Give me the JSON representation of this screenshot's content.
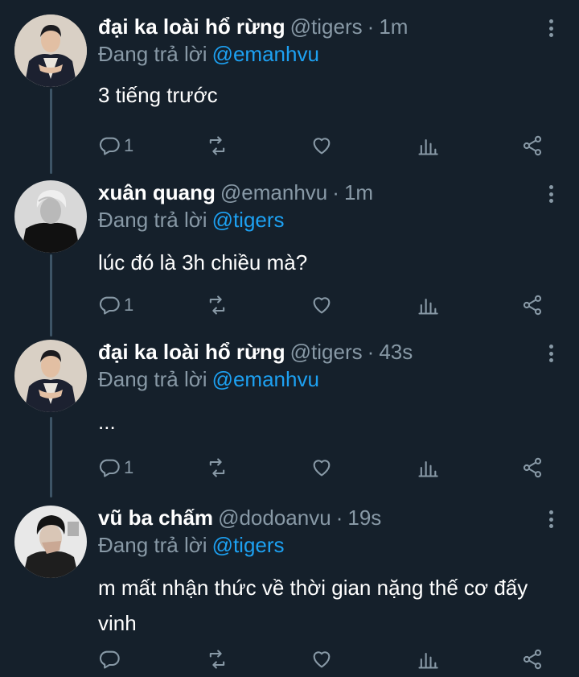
{
  "reply_prefix": "Đang trả lời",
  "colors": {
    "background": "#15202b",
    "secondary_text": "#8899a6",
    "mention": "#1da1f2",
    "thread_line": "#3d5466"
  },
  "tweets": [
    {
      "name": "đại ka loài hổ rừng",
      "handle": "@tigers",
      "time": "1m",
      "reply_to": "@emanhvu",
      "text": "3 tiếng trước",
      "reply_count": "1",
      "avatar": "tigers-avatar"
    },
    {
      "name": "xuân quang",
      "handle": "@emanhvu",
      "time": "1m",
      "reply_to": "@tigers",
      "text": "lúc đó là 3h chiều mà?",
      "reply_count": "1",
      "avatar": "emanhvu-avatar"
    },
    {
      "name": "đại ka loài hổ rừng",
      "handle": "@tigers",
      "time": "43s",
      "reply_to": "@emanhvu",
      "text": "...",
      "reply_count": "1",
      "avatar": "tigers-avatar"
    },
    {
      "name": "vũ ba chấm",
      "handle": "@dodoanvu",
      "time": "19s",
      "reply_to": "@tigers",
      "text": "m mất nhận thức về thời gian nặng thế cơ đấy vinh",
      "reply_count": "",
      "avatar": "dodoanvu-avatar"
    }
  ],
  "icons": {
    "reply": "reply-icon",
    "retweet": "retweet-icon",
    "like": "heart-icon",
    "analytics": "analytics-icon",
    "share": "share-icon",
    "more": "more-icon"
  }
}
